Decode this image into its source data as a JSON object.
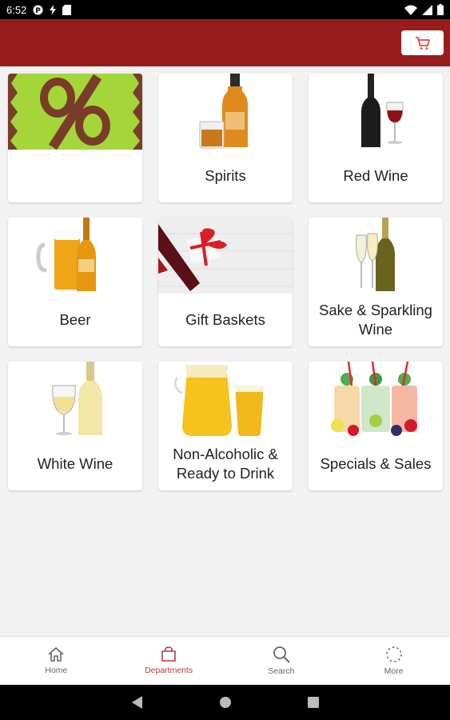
{
  "status_bar": {
    "time": "6:52"
  },
  "colors": {
    "app_bar": "#971d1d",
    "accent": "#b33a3a",
    "cart_icon": "#e8453c"
  },
  "categories": [
    {
      "label": "",
      "image": "percent-discount-icon"
    },
    {
      "label": "Spirits",
      "image": "spirits-bottle-icon"
    },
    {
      "label": "Red Wine",
      "image": "red-wine-bottle-icon"
    },
    {
      "label": "Beer",
      "image": "beer-icon"
    },
    {
      "label": "Gift Baskets",
      "image": "gift-basket-icon"
    },
    {
      "label": "Sake & Sparkling Wine",
      "image": "sparkling-wine-icon"
    },
    {
      "label": "White Wine",
      "image": "white-wine-icon"
    },
    {
      "label": "Non-Alcoholic & Ready to Drink",
      "image": "juice-pitcher-icon"
    },
    {
      "label": "Specials & Sales",
      "image": "cocktail-glasses-icon"
    }
  ],
  "bottom_nav": [
    {
      "label": "Home",
      "icon": "home-icon"
    },
    {
      "label": "Departments",
      "icon": "shopping-bag-icon",
      "active": true
    },
    {
      "label": "Search",
      "icon": "search-icon"
    },
    {
      "label": "More",
      "icon": "more-icon"
    }
  ]
}
